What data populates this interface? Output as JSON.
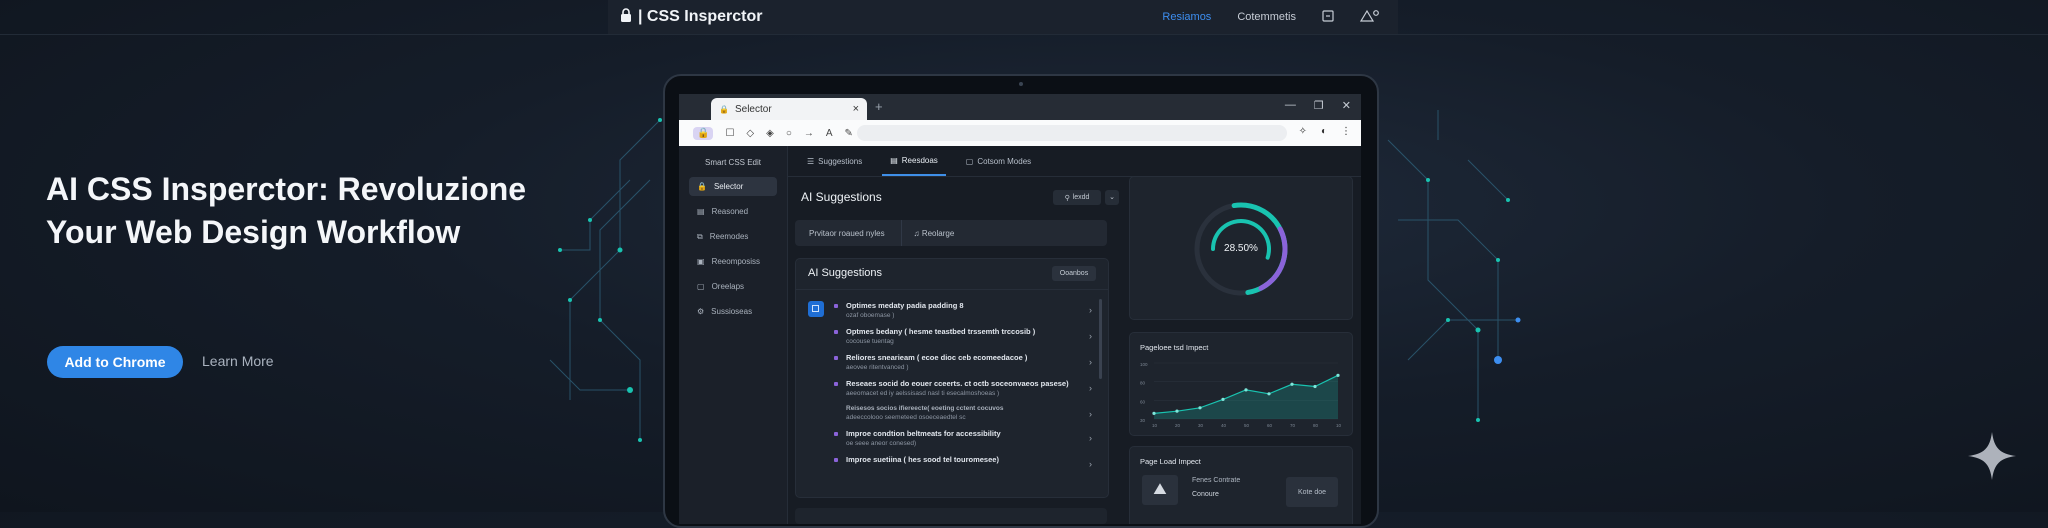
{
  "topbar": {
    "brand": "| CSS Insperctor",
    "nav": [
      "Resiamos",
      "Cotemmetis"
    ]
  },
  "hero": {
    "title": "AI CSS Insperctor: Revoluzione Your Web Design Workflow",
    "cta_label": "Add to Chrome",
    "learn_label": "Learn More"
  },
  "browser": {
    "tab_label": "Selector",
    "tab_close": "×",
    "new_tab": "+"
  },
  "sidebar": {
    "title": "Smart CSS Edit",
    "items": [
      {
        "label": "Selector"
      },
      {
        "label": "Reasoned"
      },
      {
        "label": "Reemodes"
      },
      {
        "label": "Reeomposiss"
      },
      {
        "label": "Oreelaps"
      },
      {
        "label": "Sussioseas"
      }
    ]
  },
  "tabs": [
    {
      "label": "Suggestions"
    },
    {
      "label": "Reesdoas"
    },
    {
      "label": "Cotsom Modes"
    }
  ],
  "main": {
    "heading": "AI Suggestions",
    "selector_label": "lexdd",
    "filter_left": "Prvitaor roaued nyles",
    "filter_right": "Reolarge",
    "card_title": "AI Suggestions",
    "card_button": "Ooanbos",
    "items": [
      {
        "title": "Optimes medaty padia padding 8",
        "sub": "ozaf oboemase )"
      },
      {
        "title": "Optmes bedany ( hesme teastbed trssemth trccosib )",
        "sub": "cocouse tuentag"
      },
      {
        "title": "Reliores snearieam ( ecoe dioc ceb ecomeedacoe )",
        "sub": "aeovee ritentvanced )"
      },
      {
        "title": "Reseaes socid do eouer cceerts. ct octb soceonvaeos pasese)",
        "sub": "aeeomacet ed iy aelssisasd nasl ti esecalmoshoeas )"
      },
      {
        "title": "Reisesos socios ifiereecte( eoeting cctent cocuvos ",
        "sub": "adeeccolooo seemeteed osoeceaedtel sc"
      },
      {
        "title": "Improe condtion beltmeats for accessibility",
        "sub": "oe seee aneor conesed)"
      },
      {
        "title": "Improe suetiina ( hes sood tel touromesee)",
        "sub": ""
      }
    ]
  },
  "right": {
    "gauge_value": "28.50%",
    "gauge_fraction": 0.285,
    "chart_title": "Pageloee tsd Impect",
    "chart_ticks_y": [
      "100",
      "80",
      "60",
      "30"
    ],
    "chart_ticks_x": [
      "10",
      "20",
      "30",
      "40",
      "50",
      "60",
      "70",
      "80",
      "10"
    ],
    "page_load_title": "Page Load Impect",
    "pl_line1": "Fenes Contrate",
    "pl_line2": "Conoure",
    "pl_button": "Kote doe"
  },
  "chart_data": {
    "type": "area",
    "title": "Pageloee tsd Impect",
    "x": [
      "10",
      "20",
      "30",
      "40",
      "50",
      "60",
      "70",
      "80",
      "10"
    ],
    "values": [
      10,
      14,
      20,
      35,
      52,
      45,
      62,
      58,
      78
    ],
    "ylim": [
      0,
      100
    ],
    "color": "#19c3b0"
  },
  "colors": {
    "accent": "#2f86e6",
    "teal": "#19c3b0",
    "purple": "#8b63d9"
  }
}
